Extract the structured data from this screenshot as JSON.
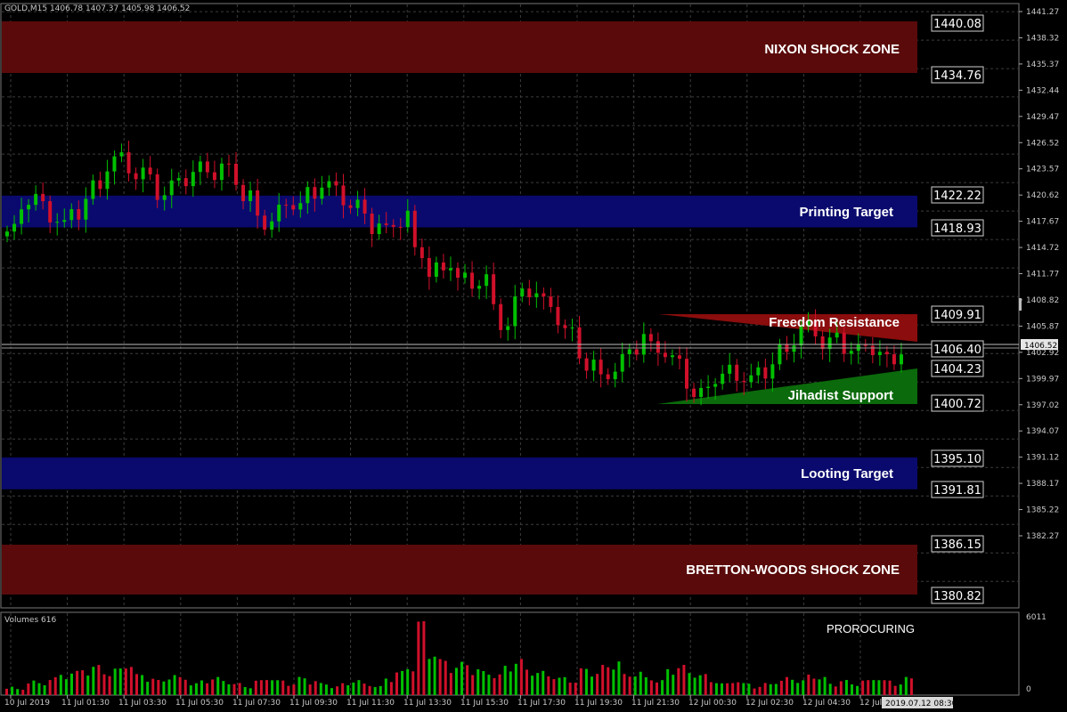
{
  "header": {
    "symbol_info": "GOLD,M15  1406.78 1407.37 1405.98 1406.52"
  },
  "volume_panel": {
    "label": "Volumes 616",
    "indicator_label": "PROROCURING",
    "scale_top": "6011",
    "scale_bottom": "0"
  },
  "colors": {
    "bull": "#00c000",
    "bear": "#d0102a",
    "red_zone": "#5a0a0a",
    "blue_zone": "#0a0a6e",
    "grid": "#4a4a4a"
  },
  "zones": [
    {
      "label": "NIXON SHOCK ZONE",
      "top_price": 1440.95,
      "bottom_price": 1434.76,
      "color": "#5a0a0a"
    },
    {
      "label": "Printing Target",
      "top_price": 1422.22,
      "bottom_price": 1418.93,
      "color": "#0a0a6e"
    },
    {
      "label": "Looting Target",
      "top_price": 1395.1,
      "bottom_price": 1391.81,
      "color": "#0a0a6e"
    },
    {
      "label": "BRETTON-WOODS SHOCK ZONE",
      "top_price": 1386.15,
      "bottom_price": 1380.82,
      "color": "#5a0a0a"
    }
  ],
  "price_boxes": [
    "1440.08",
    "1434.76",
    "1422.22",
    "1418.93",
    "1409.91",
    "1406.40",
    "1404.23",
    "1400.72",
    "1395.10",
    "1391.81",
    "1386.15",
    "1380.82"
  ],
  "current_price": "1406.52",
  "triangles": [
    {
      "label": "Freedom Resistance",
      "color": "#8b0d0d"
    },
    {
      "label": "Jihadist Support",
      "color": "#0b6a0b"
    }
  ],
  "time_cursor": "2019.07.12 08:30",
  "chart_data": {
    "type": "candlestick",
    "ylim": [
      1380.0,
      1441.27
    ],
    "y_ticks": [
      "1441.27",
      "1438.32",
      "1435.37",
      "1432.44",
      "1429.47",
      "1426.52",
      "1423.57",
      "1420.62",
      "1417.67",
      "1414.72",
      "1411.77",
      "1408.82",
      "1405.87",
      "1402.92",
      "1399.97",
      "1397.02",
      "1394.07",
      "1391.12",
      "1388.17",
      "1385.22",
      "1382.27"
    ],
    "x_ticks": [
      "10 Jul 2019",
      "11 Jul 01:30",
      "11 Jul 03:30",
      "11 Jul 05:30",
      "11 Jul 07:30",
      "11 Jul 09:30",
      "11 Jul 11:30",
      "11 Jul 13:30",
      "11 Jul 15:30",
      "11 Jul 17:30",
      "11 Jul 19:30",
      "11 Jul 21:30",
      "12 Jul 00:30",
      "12 Jul 02:30",
      "12 Jul 04:30",
      "12 Jul 06:30"
    ],
    "close_path": [
      1418.5,
      1421.0,
      1422.0,
      1421.0,
      1420.0,
      1419.0,
      1420.5,
      1422.0,
      1423.0,
      1425.5,
      1426.0,
      1425.0,
      1424.5,
      1424.0,
      1422.5,
      1423.0,
      1424.0,
      1424.5,
      1425.0,
      1424.5,
      1425.0,
      1424.0,
      1422.0,
      1420.0,
      1419.5,
      1420.5,
      1421.5,
      1421.0,
      1422.5,
      1423.5,
      1423.0,
      1422.0,
      1421.0,
      1420.5,
      1419.0,
      1418.5,
      1419.5,
      1420.0,
      1416.5,
      1414.0,
      1414.5,
      1415.5,
      1413.5,
      1413.0,
      1413.5,
      1410.5,
      1409.0,
      1411.0,
      1412.5,
      1412.0,
      1411.0,
      1409.5,
      1408.0,
      1406.0,
      1404.5,
      1403.5,
      1404.0,
      1405.0,
      1406.5,
      1407.5,
      1406.5,
      1406.0,
      1405.0,
      1403.0,
      1401.5,
      1402.5,
      1403.5,
      1404.0,
      1403.5,
      1403.0,
      1404.0,
      1405.0,
      1406.0,
      1407.5,
      1408.5,
      1408.0,
      1407.0,
      1407.5,
      1406.5,
      1406.0,
      1406.5,
      1406.0,
      1405.0,
      1406.5
    ],
    "volume_profile": [
      3,
      2,
      5,
      4,
      6,
      7,
      8,
      9,
      10,
      8,
      9,
      11,
      7,
      6,
      5,
      7,
      6,
      4,
      5,
      6,
      5,
      4,
      3,
      5,
      6,
      5,
      4,
      6,
      5,
      4,
      3,
      4,
      5,
      4,
      3,
      6,
      8,
      10,
      25,
      15,
      12,
      10,
      11,
      9,
      8,
      7,
      10,
      12,
      9,
      8,
      7,
      6,
      5,
      9,
      8,
      10,
      12,
      7,
      8,
      6,
      5,
      9,
      10,
      8,
      7,
      5,
      4,
      5,
      4,
      3,
      4,
      5,
      6,
      5,
      7,
      6,
      4,
      5,
      4,
      5,
      6,
      5,
      4,
      6
    ]
  }
}
